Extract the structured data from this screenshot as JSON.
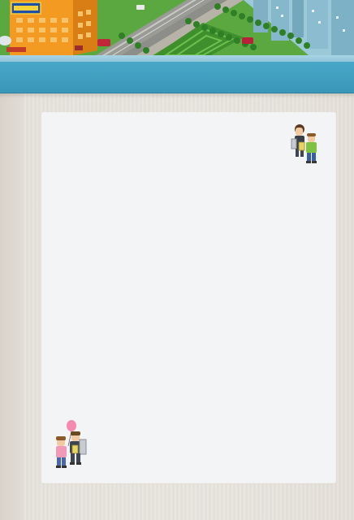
{
  "header": {
    "hotel_sign_text": "",
    "sky_color": "#8fc2d4",
    "grass_color": "#4fa33a"
  },
  "navigation": {
    "bar_color": "#3f9fc1",
    "items": []
  },
  "content_panel": {
    "background": "#f3f4f6",
    "decorations": [
      {
        "icon": "avatar-pair-top-right-icon"
      },
      {
        "icon": "avatar-pair-balloon-bottom-left-icon"
      }
    ]
  }
}
